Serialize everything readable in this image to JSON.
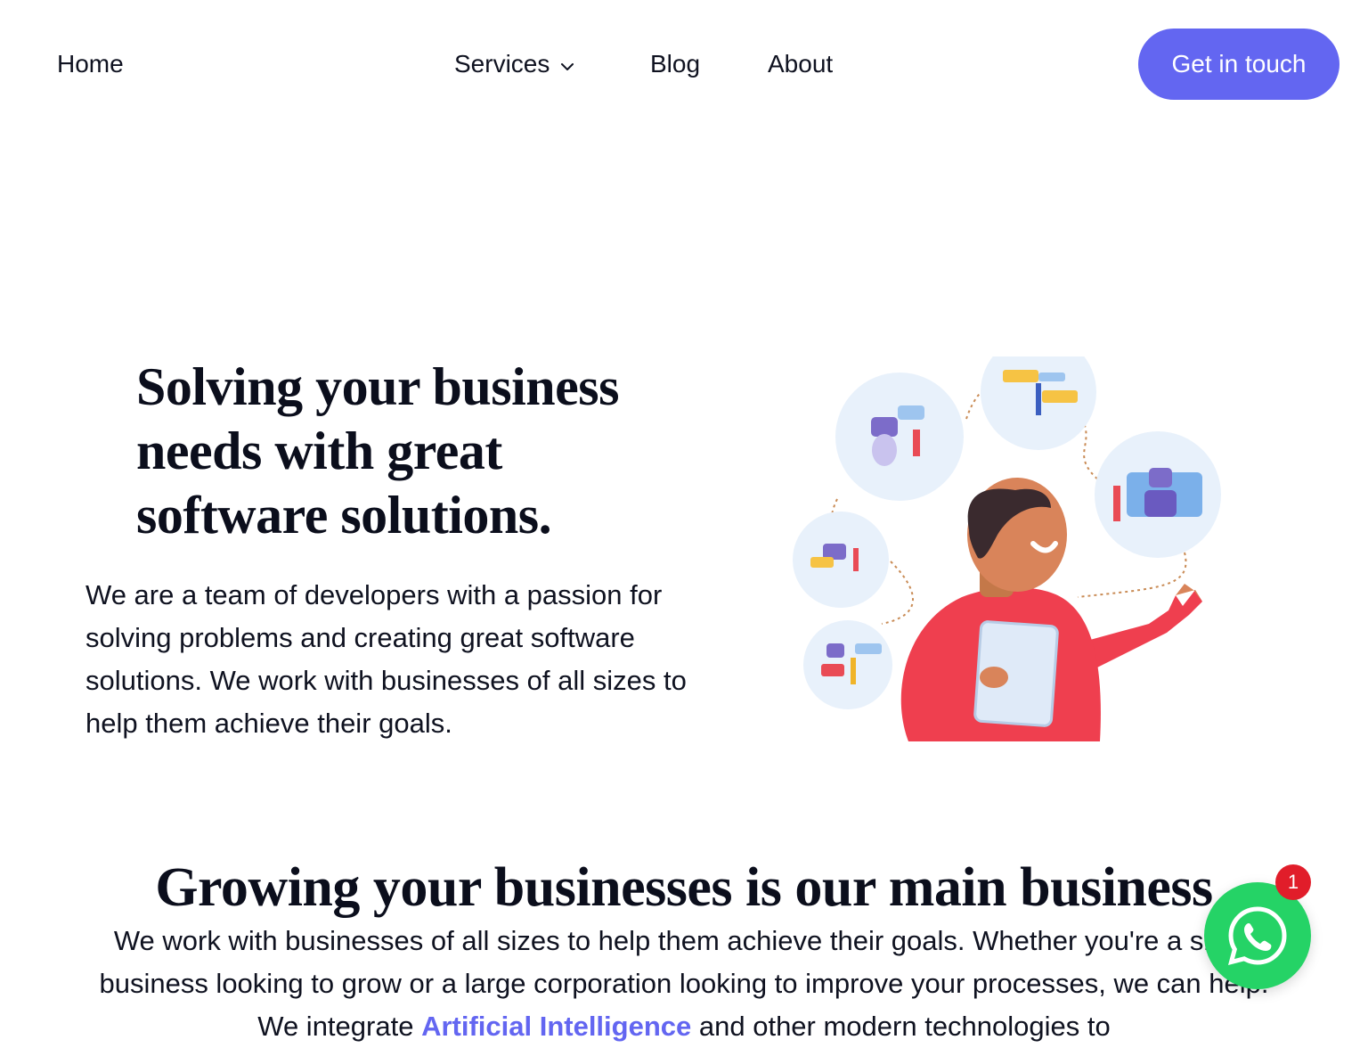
{
  "nav": {
    "home": "Home",
    "services": "Services",
    "blog": "Blog",
    "about": "About",
    "cta": "Get in touch"
  },
  "hero": {
    "title": "Solving your business needs with great software solutions.",
    "text": "We are a team of developers with a passion for solving problems and creating great software solutions. We work with businesses of all sizes to help them achieve their goals."
  },
  "section": {
    "title": "Growing your businesses is our main business",
    "text_before": "We work with businesses of all sizes to help them achieve their goals. Whether you're a small business looking to grow or a large corporation looking to improve your processes, we can help. We integrate ",
    "ai_link": "Artificial Intelligence",
    "text_after": " and other modern technologies to"
  },
  "whatsapp": {
    "badge_count": "1",
    "icon": "whatsapp-icon"
  },
  "colors": {
    "accent": "#6366f1",
    "whatsapp": "#25d366",
    "badge": "#e11d2a",
    "illustration_red": "#ef3f4f"
  }
}
